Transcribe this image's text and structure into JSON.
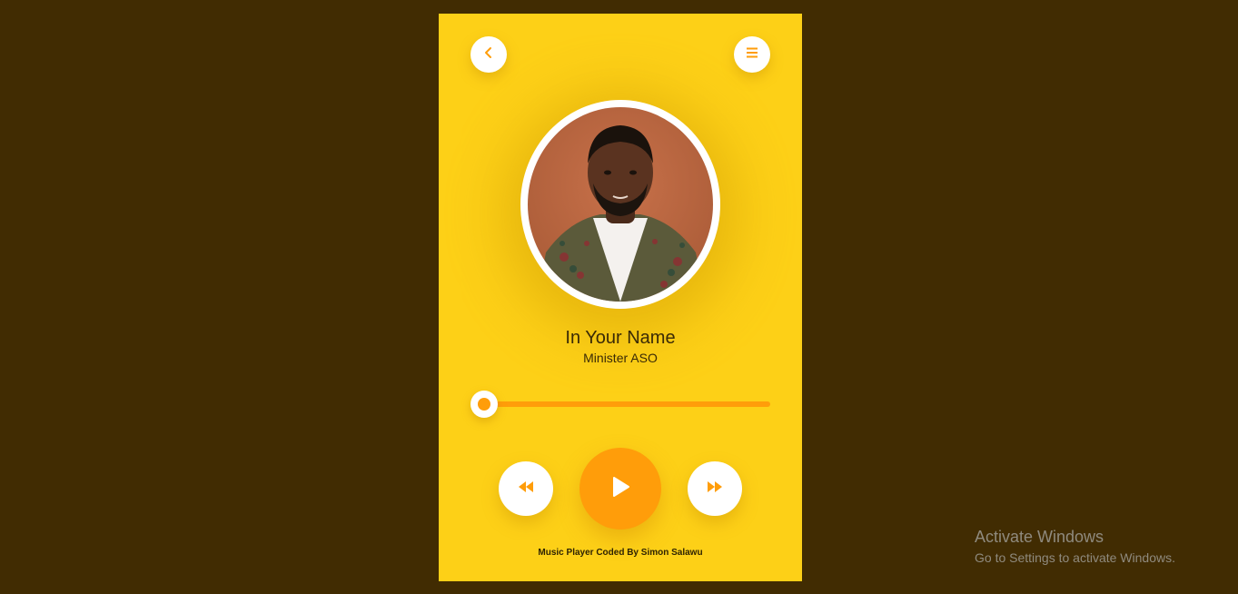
{
  "player": {
    "song_title": "In Your Name",
    "artist": "Minister ASO",
    "progress": 0.0,
    "credit": "Music Player Coded By Simon Salawu",
    "icons": {
      "back": "chevron-left-icon",
      "menu": "hamburger-menu-icon",
      "rewind": "rewind-icon",
      "play": "play-icon",
      "forward": "fast-forward-icon"
    },
    "colors": {
      "background": "#fdd017",
      "accent": "#ff9d0a",
      "page_background": "#412c02"
    }
  },
  "watermark": {
    "title": "Activate Windows",
    "subtitle": "Go to Settings to activate Windows."
  }
}
